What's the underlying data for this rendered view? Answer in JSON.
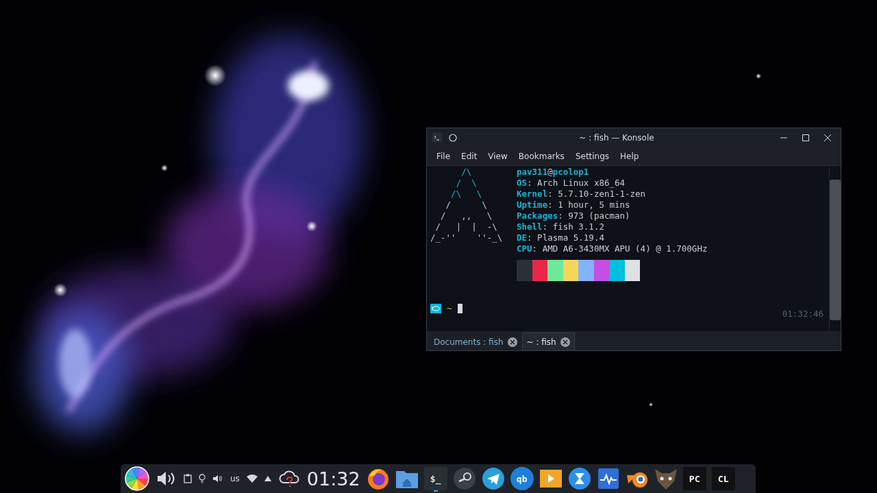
{
  "window": {
    "title": "~ : fish — Konsole",
    "menu": [
      "File",
      "Edit",
      "View",
      "Bookmarks",
      "Settings",
      "Help"
    ],
    "logo": [
      {
        "text": "      /\\",
        "highlight": true
      },
      {
        "text": "     /  \\",
        "highlight": true
      },
      {
        "text": "    /\\   \\",
        "highlight": true
      },
      {
        "text": "   /      \\",
        "highlight": false
      },
      {
        "text": "  /   ,,   \\",
        "highlight": false
      },
      {
        "text": " /   |  |  -\\",
        "highlight": false
      },
      {
        "text": "/_-''    ''-_\\",
        "highlight": false
      }
    ],
    "info": [
      "**pav311**@**pcolop1**",
      "**OS**: Arch Linux x86_64",
      "**Kernel**: 5.7.10-zen1-1-zen",
      "**Uptime**: 1 hour, 5 mins",
      "**Packages**: 973 (pacman)",
      "**Shell**: fish 3.1.2",
      "**DE**: Plasma 5.19.4",
      "**CPU**: AMD A6-3430MX APU (4) @ 1.700GHz"
    ],
    "palette": [
      {
        "color": "#2b2f38"
      },
      {
        "color": "#e9274a"
      },
      {
        "color": "#6fe89a"
      },
      {
        "color": "#f6d65a"
      },
      {
        "color": "#82b3fc"
      },
      {
        "color": "#c54ee6"
      },
      {
        "color": "#00c0e0"
      },
      {
        "color": "#dde0e4"
      }
    ],
    "prompt": {
      "path": "~",
      "time": "01:32:46"
    },
    "tabs": [
      {
        "label": "Documents : fish",
        "selected": false
      },
      {
        "label": "~ : fish",
        "selected": true
      }
    ]
  },
  "taskbar": {
    "keyboard": "us",
    "clock": "01:32",
    "apps": [
      {
        "kind": "firefox",
        "active": false
      },
      {
        "kind": "folder",
        "active": false
      },
      {
        "kind": "terminal",
        "label": "$_",
        "active": true
      },
      {
        "kind": "steam",
        "active": false
      },
      {
        "kind": "telegram",
        "active": false
      },
      {
        "kind": "qbittorrent",
        "label": "qb",
        "active": false
      },
      {
        "kind": "player",
        "active": false
      },
      {
        "kind": "hourglass",
        "active": false
      },
      {
        "kind": "monitor",
        "active": false
      },
      {
        "kind": "blender",
        "active": false
      },
      {
        "kind": "animal",
        "active": false
      },
      {
        "kind": "pycharm",
        "label": "PC",
        "active": false
      },
      {
        "kind": "clion",
        "label": "CL",
        "active": false
      }
    ]
  }
}
